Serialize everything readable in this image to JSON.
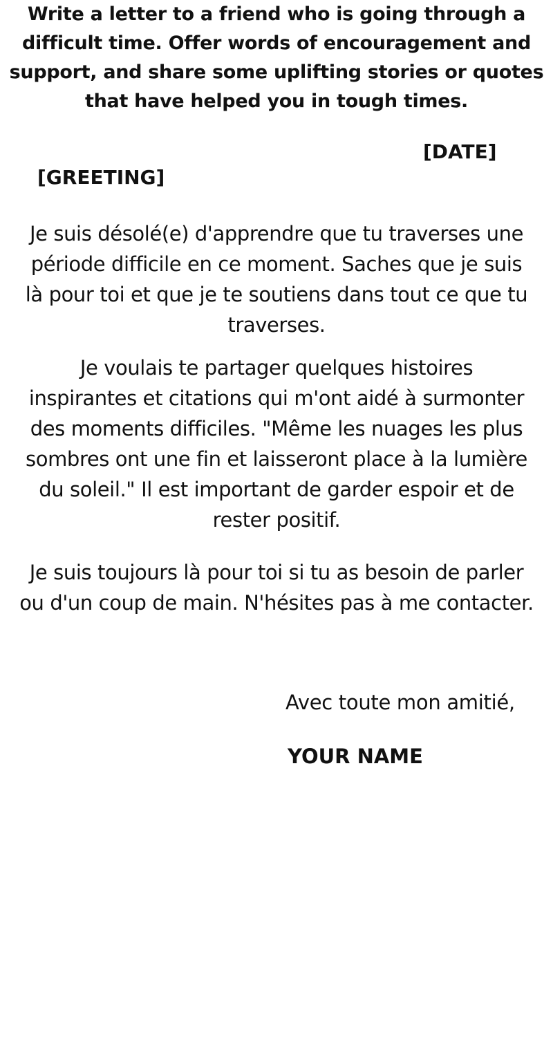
{
  "prompt": {
    "line1": "Write a letter to a friend who is going through a",
    "line2": "difficult time. Offer words of encouragement and",
    "line3": "support, and share some uplifting stories or quotes",
    "line4": "that have helped you in tough times."
  },
  "header": {
    "date": "[DATE]",
    "greeting": "[GREETING]"
  },
  "body": {
    "p1": {
      "l1": "Je suis désolé(e) d'apprendre que tu traverses une",
      "l2": "période difficile en ce moment. Saches que je suis",
      "l3": "là pour toi et que je te soutiens dans tout ce que tu",
      "l4": "traverses."
    },
    "p2": {
      "l1": "Je voulais te partager quelques histoires",
      "l2": "inspirantes et citations qui m'ont aidé à surmonter",
      "l3": "des moments difficiles. \"Même les nuages les plus",
      "l4": "sombres ont une fin et laisseront place à la lumière",
      "l5": "du soleil.\" Il est important de garder espoir et de",
      "l6": "rester positif."
    },
    "p3": {
      "l1": "Je suis toujours là pour toi si tu as besoin de parler",
      "l2": "ou d'un coup de main. N'hésites pas à me contacter."
    }
  },
  "signoff": {
    "closing": "Avec toute mon amitié,",
    "name": "YOUR NAME"
  }
}
